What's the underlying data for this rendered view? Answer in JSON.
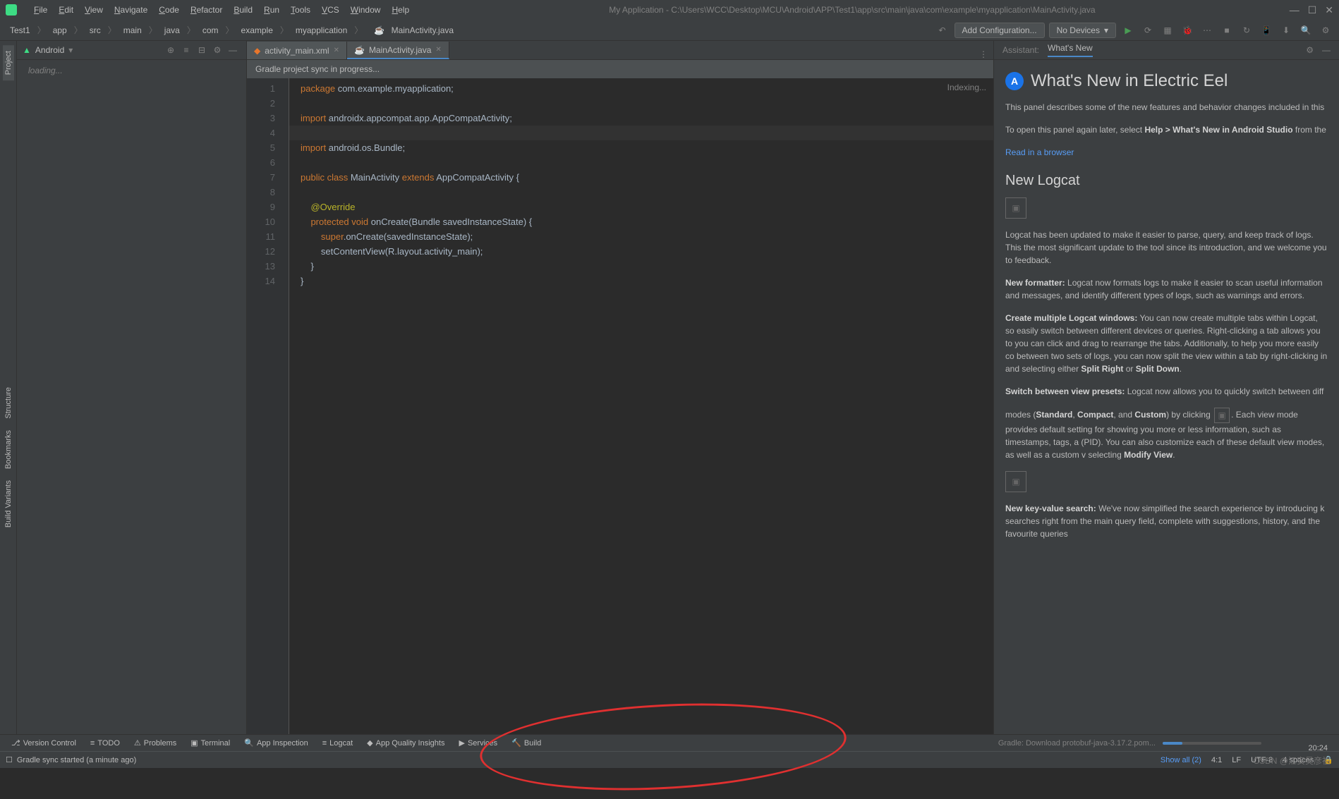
{
  "titlebar": {
    "menus": [
      "File",
      "Edit",
      "View",
      "Navigate",
      "Code",
      "Refactor",
      "Build",
      "Run",
      "Tools",
      "VCS",
      "Window",
      "Help"
    ],
    "title": "My Application - C:\\Users\\WCC\\Desktop\\MCU\\Android\\APP\\Test1\\app\\src\\main\\java\\com\\example\\myapplication\\MainActivity.java"
  },
  "breadcrumb": [
    "Test1",
    "app",
    "src",
    "main",
    "java",
    "com",
    "example",
    "myapplication",
    "MainActivity.java"
  ],
  "toolbar": {
    "add_config": "Add Configuration...",
    "no_devices": "No Devices"
  },
  "project": {
    "view_mode": "Android",
    "loading": "loading..."
  },
  "left_tabs": [
    "Project",
    "Structure",
    "Bookmarks",
    "Build Variants"
  ],
  "editor": {
    "tabs": [
      {
        "name": "activity_main.xml",
        "active": false
      },
      {
        "name": "MainActivity.java",
        "active": true
      }
    ],
    "sync_msg": "Gradle project sync in progress...",
    "indexing": "Indexing...",
    "lines": [
      {
        "n": 1,
        "tokens": [
          [
            "kw",
            "package"
          ],
          [
            "",
            " com.example.myapplication;"
          ]
        ]
      },
      {
        "n": 2,
        "tokens": [
          [
            "",
            ""
          ]
        ]
      },
      {
        "n": 3,
        "tokens": [
          [
            "kw",
            "import"
          ],
          [
            "",
            " androidx.appcompat.app.AppCompatActivity;"
          ]
        ]
      },
      {
        "n": 4,
        "tokens": [
          [
            "",
            ""
          ]
        ],
        "hl": true
      },
      {
        "n": 5,
        "tokens": [
          [
            "kw",
            "import"
          ],
          [
            "",
            " android.os.Bundle;"
          ]
        ]
      },
      {
        "n": 6,
        "tokens": [
          [
            "",
            ""
          ]
        ]
      },
      {
        "n": 7,
        "tokens": [
          [
            "kw",
            "public class"
          ],
          [
            "",
            " MainActivity "
          ],
          [
            "kw",
            "extends"
          ],
          [
            "",
            " AppCompatActivity {"
          ]
        ]
      },
      {
        "n": 8,
        "tokens": [
          [
            "",
            ""
          ]
        ]
      },
      {
        "n": 9,
        "tokens": [
          [
            "",
            "    "
          ],
          [
            "ann",
            "@Override"
          ]
        ]
      },
      {
        "n": 10,
        "tokens": [
          [
            "",
            "    "
          ],
          [
            "kw",
            "protected void"
          ],
          [
            "",
            " onCreate(Bundle savedInstanceState) {"
          ]
        ]
      },
      {
        "n": 11,
        "tokens": [
          [
            "",
            "        "
          ],
          [
            "kw",
            "super"
          ],
          [
            "",
            ".onCreate(savedInstanceState);"
          ]
        ]
      },
      {
        "n": 12,
        "tokens": [
          [
            "",
            "        setContentView(R.layout."
          ],
          [
            "",
            "activity_main"
          ],
          [
            "",
            ");"
          ]
        ]
      },
      {
        "n": 13,
        "tokens": [
          [
            "",
            "    }"
          ]
        ]
      },
      {
        "n": 14,
        "tokens": [
          [
            "",
            "}"
          ]
        ]
      }
    ]
  },
  "assistant": {
    "header_label": "Assistant:",
    "header_tab": "What's New",
    "title": "What's New in Electric Eel",
    "p1": "This panel describes some of the new features and behavior changes included in this",
    "p2_pre": "To open this panel again later, select ",
    "p2_bold": "Help > What's New in Android Studio",
    "p2_post": " from the",
    "read_link": "Read in a browser",
    "h2_logcat": "New Logcat",
    "p3": "Logcat has been updated to make it easier to parse, query, and keep track of logs. This the most significant update to the tool since its introduction, and we welcome you to feedback.",
    "p4_bold": "New formatter:",
    "p4": " Logcat now formats logs to make it easier to scan useful information and messages, and identify different types of logs, such as warnings and errors.",
    "p5_bold": "Create multiple Logcat windows:",
    "p5": " You can now create multiple tabs within Logcat, so easily switch between different devices or queries. Right-clicking a tab allows you to you can click and drag to rearrange the tabs. Additionally, to help you more easily co between two sets of logs, you can now split the view within a tab by right-clicking in and selecting either ",
    "p5_b1": "Split Right",
    "p5_mid": " or ",
    "p5_b2": "Split Down",
    "p6_bold": "Switch between view presets:",
    "p6a": " Logcat now allows you to quickly switch between diff",
    "p6b_pre": "modes (",
    "p6b_1": "Standard",
    "p6b_c1": ", ",
    "p6b_2": "Compact",
    "p6b_c2": ", and ",
    "p6b_3": "Custom",
    "p6b_post": ") by clicking ",
    "p6c": ". Each view mode provides default setting for showing you more or less information, such as timestamps, tags, a (PID). You can also customize each of these default view modes, as well as a custom v selecting ",
    "p6c_bold": "Modify View",
    "p7_bold": "New key-value search:",
    "p7": " We've now simplified the search experience by introducing k searches right from the main query field, complete with suggestions, history, and the favourite queries"
  },
  "bottom_tabs": [
    "Version Control",
    "TODO",
    "Problems",
    "Terminal",
    "App Inspection",
    "Logcat",
    "App Quality Insights",
    "Services",
    "Build"
  ],
  "progress": {
    "text": "Gradle: Download protobuf-java-3.17.2.pom..."
  },
  "status": {
    "left": "Gradle sync started (a minute ago)",
    "show_all": "Show all (2)",
    "pos": "4:1",
    "lf": "LF",
    "enc": "UTF-8",
    "indent": "4 spaces"
  },
  "watermark": "CSDN @江安吴彦祖",
  "time": "20:24"
}
